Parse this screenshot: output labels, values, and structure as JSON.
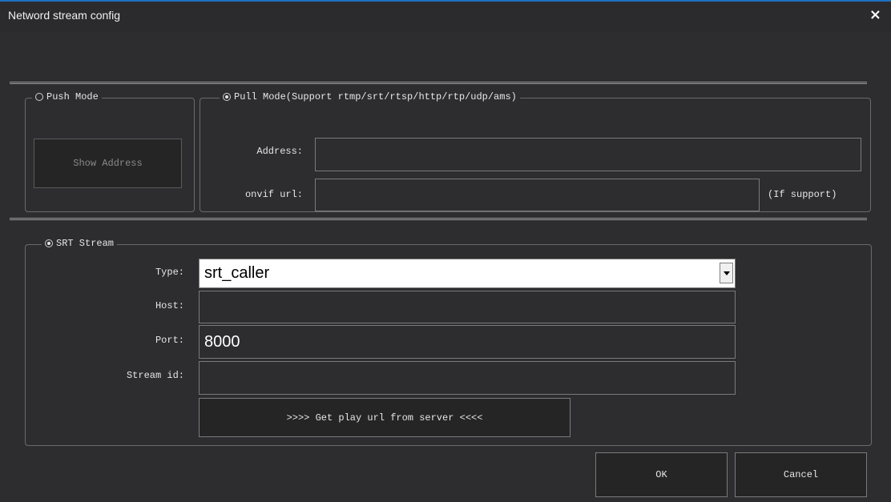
{
  "window": {
    "title": "Netword stream config",
    "close_icon": "×"
  },
  "push_mode": {
    "label": "Push Mode",
    "selected": false,
    "show_address_label": "Show Address"
  },
  "pull_mode": {
    "label": "Pull Mode(Support rtmp/srt/rtsp/http/rtp/udp/ams)",
    "selected": true,
    "address_label": "Address:",
    "address_value": "",
    "onvif_label": "onvif url:",
    "onvif_value": "",
    "onvif_hint": "(If support)"
  },
  "srt": {
    "label": "SRT Stream",
    "selected": true,
    "type_label": "Type:",
    "type_value": "srt_caller",
    "host_label": "Host:",
    "host_value": "",
    "port_label": "Port:",
    "port_value": "8000",
    "stream_id_label": "Stream id:",
    "stream_id_value": "",
    "get_url_label": ">>>> Get play url from server <<<<"
  },
  "footer": {
    "ok_label": "OK",
    "cancel_label": "Cancel"
  }
}
